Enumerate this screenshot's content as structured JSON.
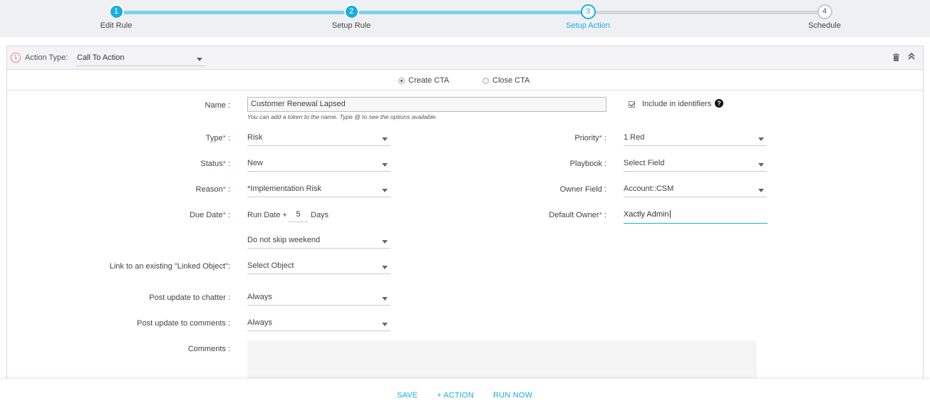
{
  "wizard": {
    "steps": [
      {
        "num": "1",
        "label": "Edit Rule"
      },
      {
        "num": "2",
        "label": "Setup Rule"
      },
      {
        "num": "3",
        "label": "Setup Action"
      },
      {
        "num": "4",
        "label": "Schedule"
      }
    ]
  },
  "action": {
    "index": "1",
    "type_label": "Action Type:",
    "type_value": "Call To Action",
    "radio": {
      "create": "Create CTA",
      "close": "Close CTA",
      "selected": "create"
    }
  },
  "form": {
    "name": {
      "label": "Name :",
      "value": "Customer Renewal Lapsed",
      "hint": "You can add a token to the name. Type @ to see the options available."
    },
    "include_identifiers": {
      "label": "Include in identifiers",
      "checked": true
    },
    "type": {
      "label": "Type",
      "suffix": " :",
      "value": "Risk"
    },
    "priority": {
      "label": "Priority",
      "suffix": " :",
      "value": "1 Red"
    },
    "status": {
      "label": "Status",
      "suffix": " :",
      "value": "New"
    },
    "playbook": {
      "label": "Playbook :",
      "value": "Select Field"
    },
    "reason": {
      "label": "Reason",
      "suffix": " :",
      "value": "*Implementation Risk"
    },
    "owner_field": {
      "label": "Owner Field :",
      "value": "Account::CSM"
    },
    "due_date": {
      "label": "Due Date",
      "suffix": " :",
      "prefix": "Run Date +",
      "days_value": "5",
      "days_label": "Days",
      "skip_value": "Do not skip weekend"
    },
    "default_owner": {
      "label": "Default Owner",
      "suffix": " :",
      "value": "Xactly Admin"
    },
    "linked_object": {
      "label": "Link to an existing \"Linked Object\":",
      "value": "Select Object"
    },
    "post_chatter": {
      "label": "Post update to chatter :",
      "value": "Always"
    },
    "post_comments": {
      "label": "Post update to comments :",
      "value": "Always"
    },
    "comments": {
      "label": "Comments :",
      "value": ""
    }
  },
  "footer": {
    "save": "SAVE",
    "add_action": "+ ACTION",
    "run_now": "RUN NOW"
  },
  "colors": {
    "accent": "#1aaee0",
    "required": "#d9534f"
  }
}
